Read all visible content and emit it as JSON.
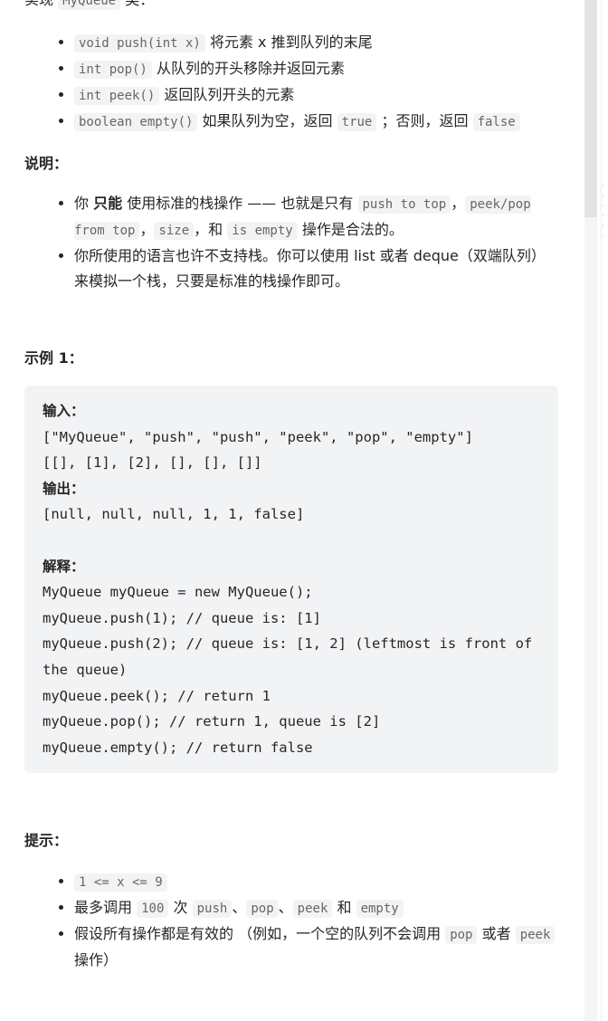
{
  "intro": {
    "prefix": "实现",
    "code": "MyQueue",
    "suffix": "类："
  },
  "methods": [
    {
      "code": "void push(int x)",
      "text": "将元素 x 推到队列的末尾"
    },
    {
      "code": "int pop()",
      "text": "从队列的开头移除并返回元素"
    },
    {
      "code": "int peek()",
      "text": "返回队列开头的元素"
    },
    {
      "code": "boolean empty()",
      "text": "如果队列为空，返回",
      "code2": "true",
      "text2": "；否则，返回",
      "code3": "false"
    }
  ],
  "notes": {
    "heading": "说明：",
    "item1": {
      "a": "你",
      "bold": "只能",
      "b": "使用标准的栈操作 —— 也就是只有",
      "c1": "push to top",
      "s1": "，",
      "c2": "peek/pop from top",
      "s2": "，",
      "c3": "size",
      "s3": "，和",
      "c4": "is empty",
      "end": "操作是合法的。"
    },
    "item2": "你所使用的语言也许不支持栈。你可以使用 list 或者 deque（双端队列）来模拟一个栈，只要是标准的栈操作即可。"
  },
  "example": {
    "heading": "示例 1：",
    "input_label": "输入：",
    "input_lines": [
      "[\"MyQueue\", \"push\", \"push\", \"peek\", \"pop\", \"empty\"]",
      "[[], [1], [2], [], [], []]"
    ],
    "output_label": "输出：",
    "output": "[null, null, null, 1, 1, false]",
    "explain_label": "解释：",
    "explain_lines": [
      "MyQueue myQueue = new MyQueue();",
      "myQueue.push(1); // queue is: [1]",
      "myQueue.push(2); // queue is: [1, 2] (leftmost is front of the queue)",
      "myQueue.peek(); // return 1",
      "myQueue.pop(); // return 1, queue is [2]",
      "myQueue.empty(); // return false"
    ]
  },
  "hints": {
    "heading": "提示：",
    "h1": "1 <= x <= 9",
    "h2": {
      "a": "最多调用",
      "c1": "100",
      "b": "次",
      "c2": "push",
      "s1": "、",
      "c3": "pop",
      "s2": "、",
      "c4": "peek",
      "c": "和",
      "c5": "empty"
    },
    "h3": {
      "a": "假设所有操作都是有效的 （例如，一个空的队列不会调用",
      "c1": "pop",
      "b": "或者",
      "c2": "peek",
      "c": "操作）"
    }
  }
}
